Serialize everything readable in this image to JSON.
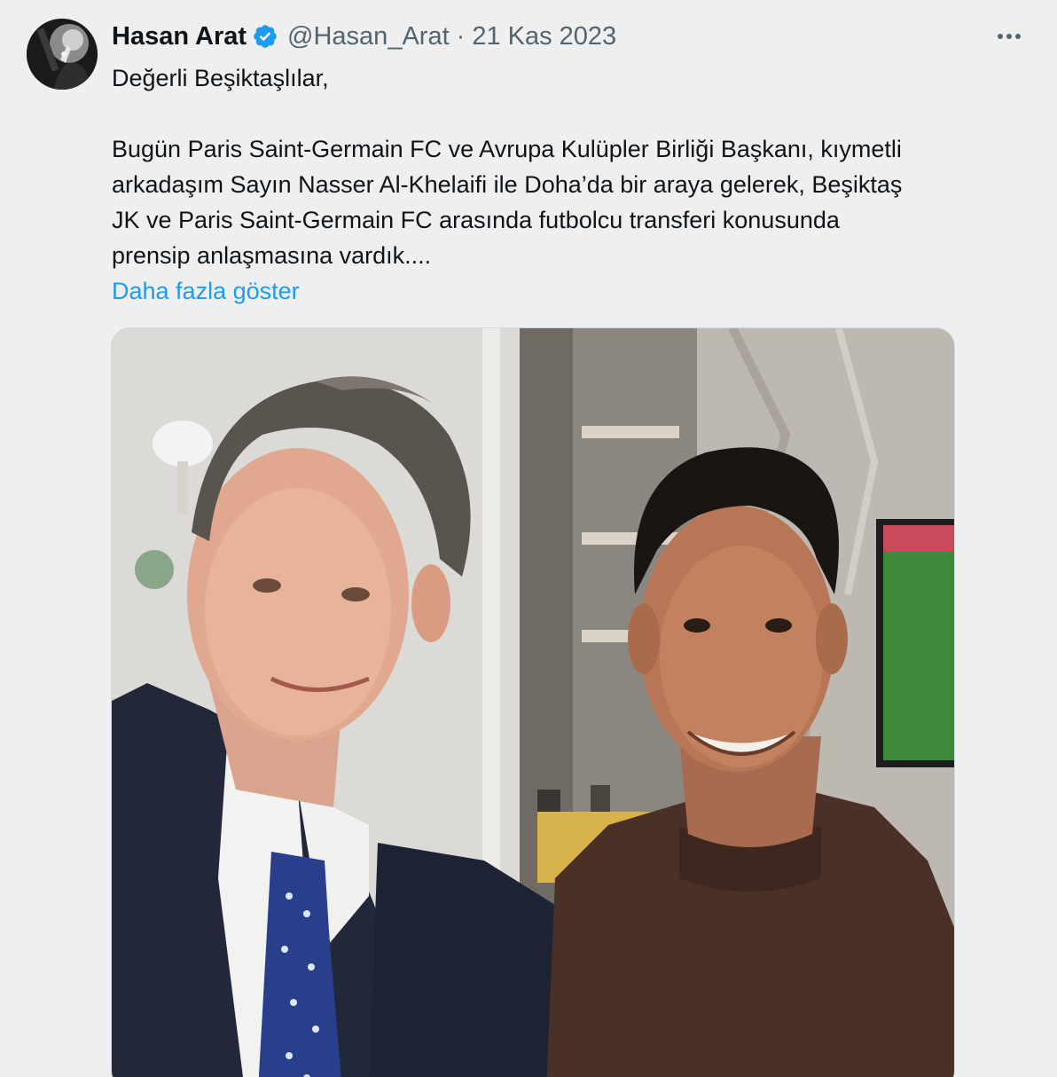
{
  "tweet": {
    "author": {
      "name": "Hasan Arat",
      "handle": "@Hasan_Arat",
      "verified": true,
      "avatar_icon": "profile-avatar"
    },
    "separator": "·",
    "date": "21 Kas 2023",
    "more_icon": "more-horizontal-icon",
    "text_lines": [
      "Değerli Beşiktaşlılar,",
      "Bugün Paris Saint-Germain FC ve Avrupa Kulüpler Birliği Başkanı, kıymetli",
      "arkadaşım Sayın Nasser Al-Khelaifi ile Doha’da bir araya gelerek, Beşiktaş",
      "JK ve Paris Saint-Germain FC arasında futbolcu transferi konusunda",
      "prensip anlaşmasına vardık...."
    ],
    "show_more": "Daha fazla göster",
    "media": {
      "type": "photo"
    }
  },
  "colors": {
    "background": "#efefef",
    "text": "#0f1419",
    "secondary_text": "#536471",
    "link": "#1d9bf0",
    "verified_badge": "#1d9bf0",
    "media_border": "#cfd9de"
  }
}
